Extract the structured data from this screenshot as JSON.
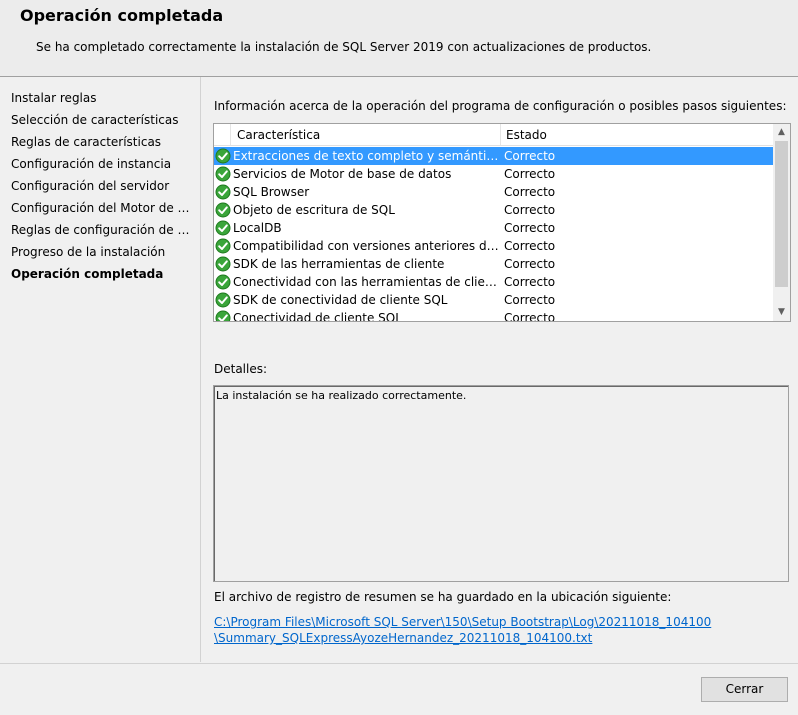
{
  "header": {
    "title": "Operación completada",
    "subtitle": "Se ha completado correctamente la instalación de SQL Server 2019 con actualizaciones de productos."
  },
  "sidebar": {
    "steps": [
      {
        "label": "Instalar reglas"
      },
      {
        "label": "Selección de características"
      },
      {
        "label": "Reglas de características"
      },
      {
        "label": "Configuración de instancia"
      },
      {
        "label": "Configuración del servidor"
      },
      {
        "label": "Configuración del Motor de ba..."
      },
      {
        "label": "Reglas de configuración de car..."
      },
      {
        "label": "Progreso de la instalación"
      },
      {
        "label": "Operación completada"
      }
    ],
    "active_index": 8
  },
  "main": {
    "info_label": "Información acerca de la operación del programa de configuración o posibles pasos siguientes:",
    "table": {
      "columns": [
        "Característica",
        "Estado"
      ],
      "rows": [
        {
          "feature": "Extracciones de texto completo y semánticas de ...",
          "status": "Correcto",
          "icon": "success-check-icon"
        },
        {
          "feature": "Servicios de Motor de base de datos",
          "status": "Correcto",
          "icon": "success-check-icon"
        },
        {
          "feature": "SQL Browser",
          "status": "Correcto",
          "icon": "success-check-icon"
        },
        {
          "feature": "Objeto de escritura de SQL",
          "status": "Correcto",
          "icon": "success-check-icon"
        },
        {
          "feature": "LocalDB",
          "status": "Correcto",
          "icon": "success-check-icon"
        },
        {
          "feature": "Compatibilidad con versiones anteriores de las h...",
          "status": "Correcto",
          "icon": "success-check-icon"
        },
        {
          "feature": "SDK de las herramientas de cliente",
          "status": "Correcto",
          "icon": "success-check-icon"
        },
        {
          "feature": "Conectividad con las herramientas de cliente",
          "status": "Correcto",
          "icon": "success-check-icon"
        },
        {
          "feature": "SDK de conectividad de cliente SQL",
          "status": "Correcto",
          "icon": "success-check-icon"
        },
        {
          "feature": "Conectividad de cliente SQL",
          "status": "Correcto",
          "icon": "success-check-icon"
        }
      ],
      "selected_index": 0
    },
    "details_label": "Detalles:",
    "details_text": "La instalación se ha realizado correctamente.",
    "log_label": "El archivo de registro de resumen se ha guardado en la ubicación siguiente:",
    "log_link_line1": "C:\\Program Files\\Microsoft SQL Server\\150\\Setup Bootstrap\\Log\\20211018_104100",
    "log_link_line2": "\\Summary_SQLExpressAyozeHernandez_20211018_104100.txt"
  },
  "footer": {
    "close_label": "Cerrar"
  },
  "colors": {
    "selection": "#3399ff",
    "link": "#0066cc",
    "success": "#3aa53a"
  }
}
